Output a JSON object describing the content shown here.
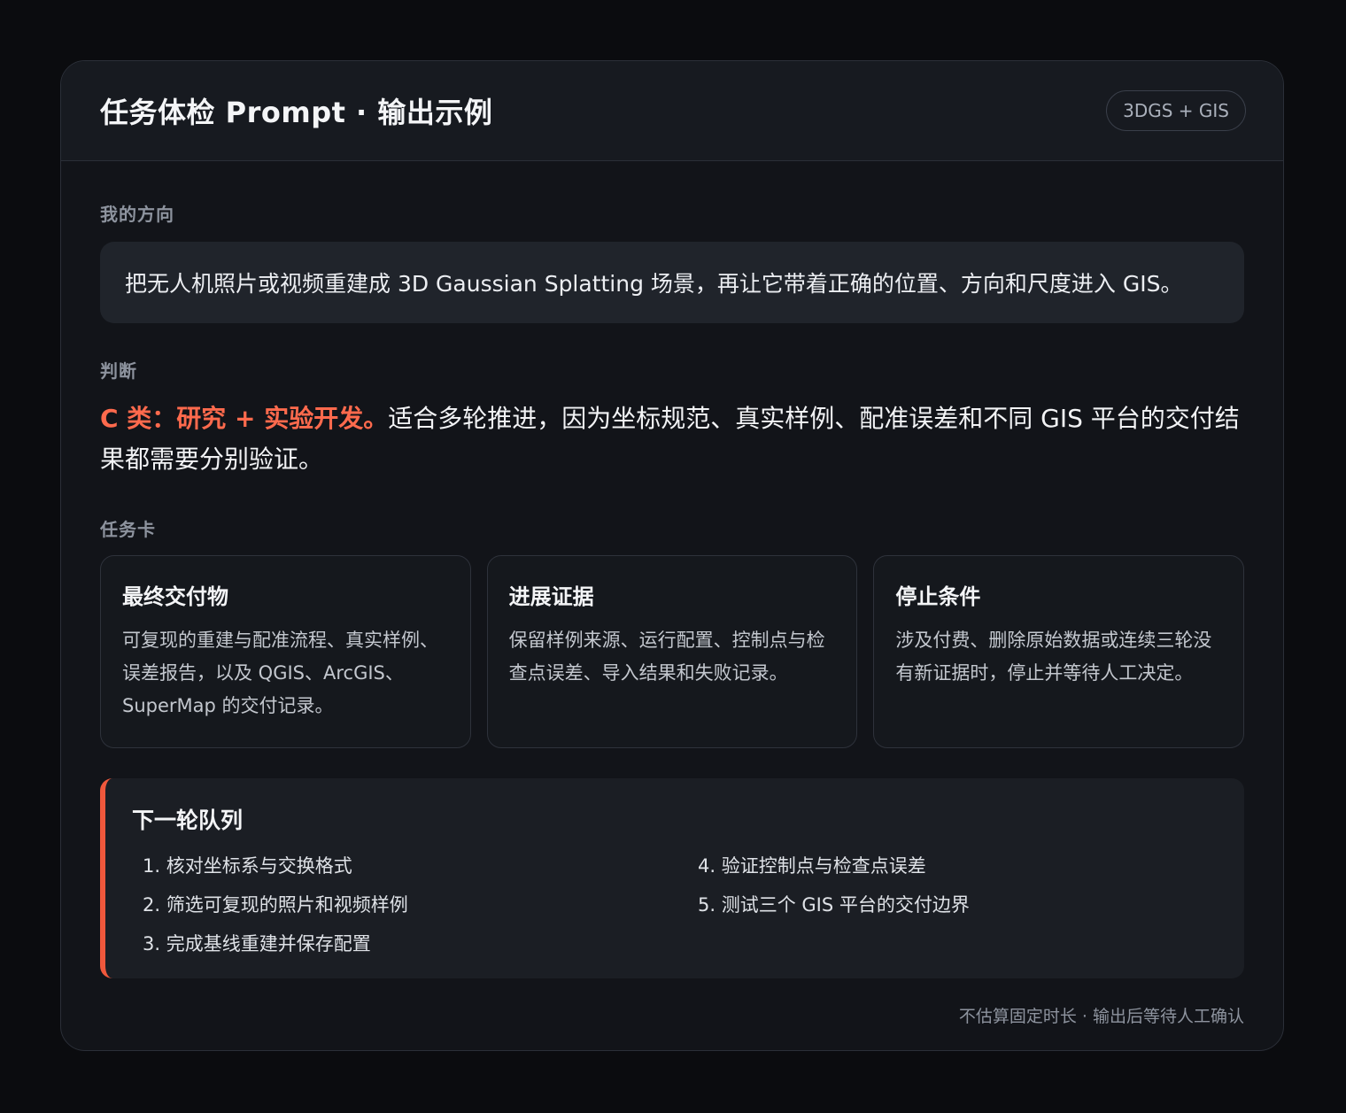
{
  "header": {
    "title": "任务体检 Prompt · 输出示例",
    "badge": "3DGS + GIS"
  },
  "direction": {
    "label": "我的方向",
    "text": "把无人机照片或视频重建成 3D Gaussian Splatting 场景，再让它带着正确的位置、方向和尺度进入 GIS。"
  },
  "judgment": {
    "label": "判断",
    "highlight": "C 类：研究 + 实验开发。",
    "text": "适合多轮推进，因为坐标规范、真实样例、配准误差和不同 GIS 平台的交付结果都需要分别验证。"
  },
  "task_cards": {
    "label": "任务卡",
    "items": [
      {
        "title": "最终交付物",
        "text": "可复现的重建与配准流程、真实样例、误差报告，以及 QGIS、ArcGIS、SuperMap 的交付记录。"
      },
      {
        "title": "进展证据",
        "text": "保留样例来源、运行配置、控制点与检查点误差、导入结果和失败记录。"
      },
      {
        "title": "停止条件",
        "text": "涉及付费、删除原始数据或连续三轮没有新证据时，停止并等待人工决定。"
      }
    ]
  },
  "queue": {
    "title": "下一轮队列",
    "items": [
      "1. 核对坐标系与交换格式",
      "2. 筛选可复现的照片和视频样例",
      "3. 完成基线重建并保存配置",
      "4. 验证控制点与检查点误差",
      "5. 测试三个 GIS 平台的交付边界"
    ]
  },
  "footer": {
    "note": "不估算固定时长 · 输出后等待人工确认"
  },
  "colors": {
    "accent": "#f0583c",
    "highlight_text": "#ff6a4d",
    "card_background": "#121419",
    "page_background": "#0b0c0f"
  }
}
